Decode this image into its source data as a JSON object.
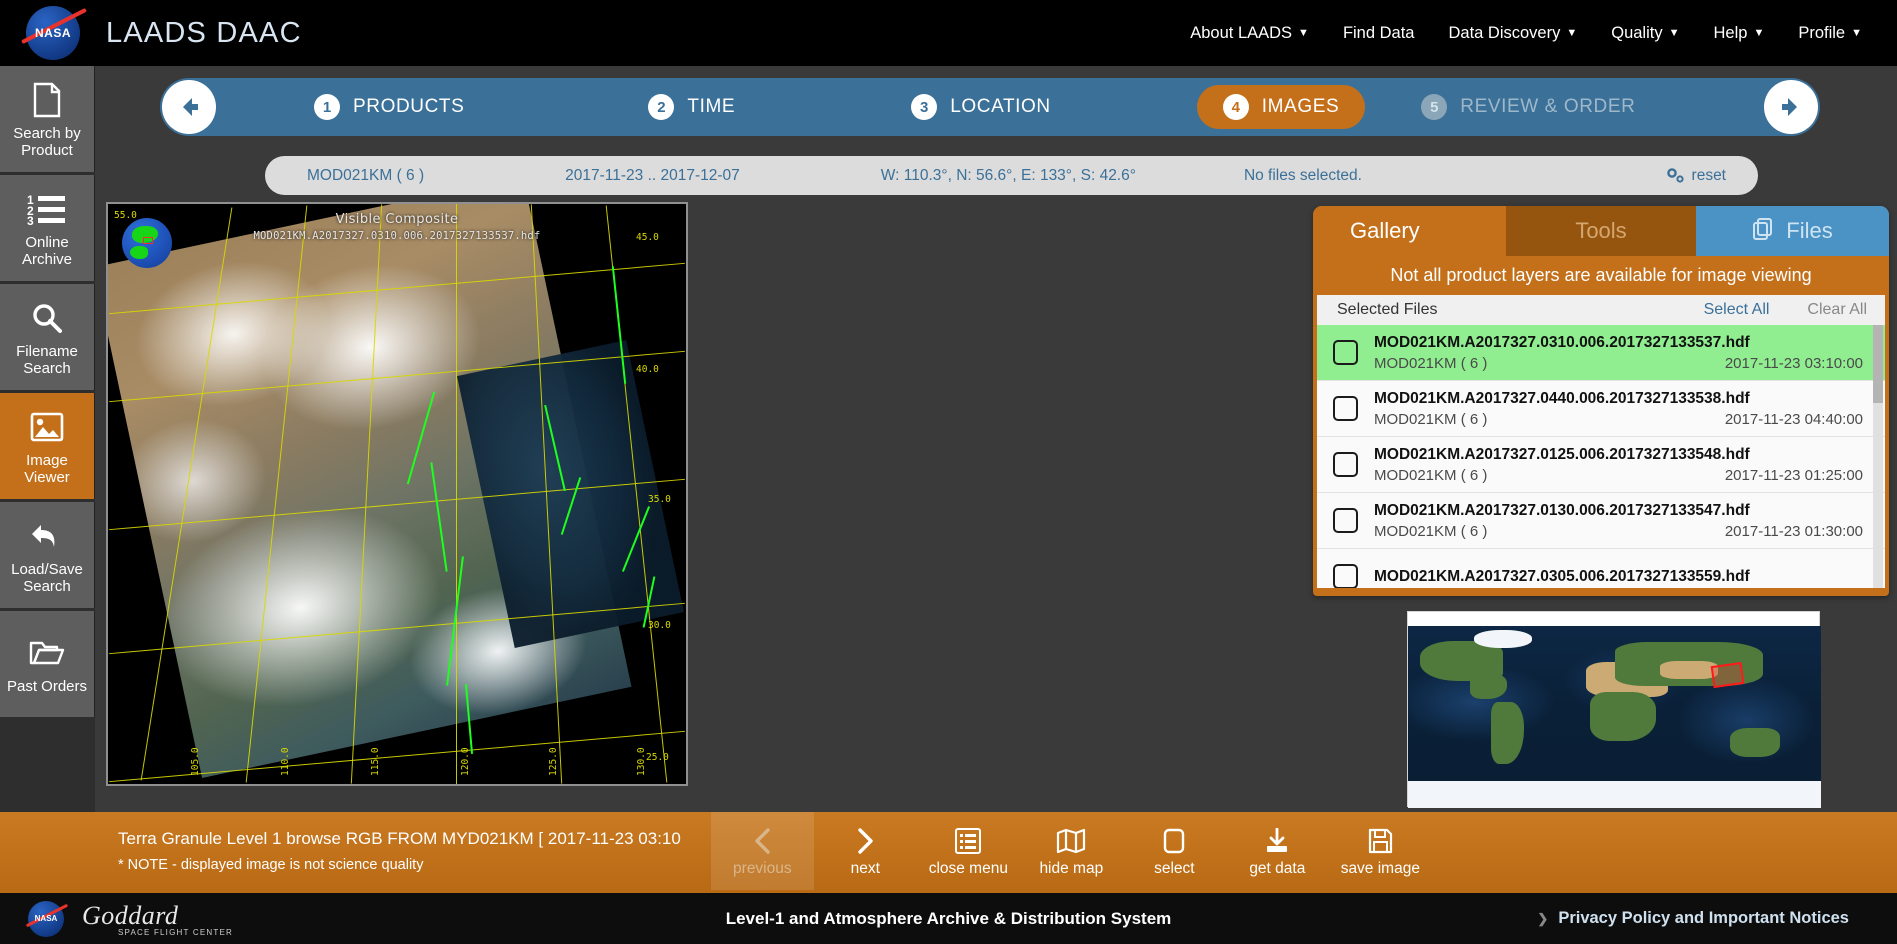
{
  "header": {
    "brand": "LAADS DAAC",
    "logo_alt": "NASA",
    "nav": [
      {
        "label": "About LAADS",
        "has_caret": true
      },
      {
        "label": "Find Data",
        "has_caret": false
      },
      {
        "label": "Data Discovery",
        "has_caret": true
      },
      {
        "label": "Quality",
        "has_caret": true
      },
      {
        "label": "Help",
        "has_caret": true
      },
      {
        "label": "Profile",
        "has_caret": true
      }
    ]
  },
  "sidebar": {
    "items": [
      {
        "label_line1": "Search by",
        "label_line2": "Product",
        "icon": "document-icon",
        "active": false
      },
      {
        "label_line1": "Online",
        "label_line2": "Archive",
        "icon": "numbered-list-icon",
        "active": false
      },
      {
        "label_line1": "Filename",
        "label_line2": "Search",
        "icon": "search-icon",
        "active": false
      },
      {
        "label_line1": "Image",
        "label_line2": "Viewer",
        "icon": "image-icon",
        "active": true
      },
      {
        "label_line1": "Load/Save",
        "label_line2": "Search",
        "icon": "undo-arrow-icon",
        "active": false
      },
      {
        "label_line1": "Past Orders",
        "label_line2": "",
        "icon": "folder-icon",
        "active": false
      }
    ]
  },
  "steps": {
    "back_label": "back",
    "forward_label": "forward",
    "items": [
      {
        "num": "1",
        "label": "PRODUCTS",
        "state": "done"
      },
      {
        "num": "2",
        "label": "TIME",
        "state": "done"
      },
      {
        "num": "3",
        "label": "LOCATION",
        "state": "done"
      },
      {
        "num": "4",
        "label": "IMAGES",
        "state": "current"
      },
      {
        "num": "5",
        "label": "REVIEW & ORDER",
        "state": "disabled"
      }
    ]
  },
  "summary": {
    "product": "MOD021KM ( 6 )",
    "time_range": "2017-11-23 .. 2017-12-07",
    "location": "W: 110.3°, N: 56.6°, E: 133°, S: 42.6°",
    "files_status": "No files selected.",
    "reset_label": "reset"
  },
  "viewer": {
    "title": "Visible Composite",
    "filename": "MOD021KM.A2017327.0310.006.2017327133537.hdf",
    "lat_labels": [
      "55.0",
      "45.0",
      "40.0",
      "35.0",
      "30.0",
      "25.0"
    ],
    "lon_labels": [
      "105.0",
      "110.0",
      "115.0",
      "120.0",
      "125.0",
      "130.0"
    ]
  },
  "gallery": {
    "tabs": [
      {
        "label": "Gallery",
        "state": "active"
      },
      {
        "label": "Tools",
        "state": "inactive"
      },
      {
        "label": "Files",
        "state": "files",
        "icon": "files-icon"
      }
    ],
    "note": "Not all product layers are available for image viewing",
    "list_header": "Selected Files",
    "select_all": "Select All",
    "clear_all": "Clear All",
    "files": [
      {
        "name": "MOD021KM.A2017327.0310.006.2017327133537.hdf",
        "product": "MOD021KM ( 6 )",
        "date": "2017-11-23 03:10:00",
        "selected": true,
        "checked": false
      },
      {
        "name": "MOD021KM.A2017327.0440.006.2017327133538.hdf",
        "product": "MOD021KM ( 6 )",
        "date": "2017-11-23 04:40:00",
        "selected": false,
        "checked": false
      },
      {
        "name": "MOD021KM.A2017327.0125.006.2017327133548.hdf",
        "product": "MOD021KM ( 6 )",
        "date": "2017-11-23 01:25:00",
        "selected": false,
        "checked": false
      },
      {
        "name": "MOD021KM.A2017327.0130.006.2017327133547.hdf",
        "product": "MOD021KM ( 6 )",
        "date": "2017-11-23 01:30:00",
        "selected": false,
        "checked": false
      },
      {
        "name": "MOD021KM.A2017327.0305.006.2017327133559.hdf",
        "product": "",
        "date": "",
        "selected": false,
        "checked": false
      }
    ]
  },
  "bottom": {
    "caption_line1": "Terra Granule Level 1 browse RGB FROM MYD021KM   [ 2017-11-23 03:10",
    "caption_line2": "* NOTE - displayed image is not science quality",
    "actions": [
      {
        "label": "previous",
        "icon": "chevron-left-icon",
        "disabled": true
      },
      {
        "label": "next",
        "icon": "chevron-right-icon",
        "disabled": false
      },
      {
        "label": "close menu",
        "icon": "list-icon",
        "disabled": false
      },
      {
        "label": "hide map",
        "icon": "map-icon",
        "disabled": false
      },
      {
        "label": "select",
        "icon": "checkbox-icon",
        "disabled": false
      },
      {
        "label": "get data",
        "icon": "download-icon",
        "disabled": false
      },
      {
        "label": "save image",
        "icon": "floppy-disk-icon",
        "disabled": false
      }
    ]
  },
  "footer": {
    "goddard_line1": "Goddard",
    "goddard_line2": "SPACE FLIGHT CENTER",
    "title": "Level-1 and Atmosphere Archive & Distribution System",
    "privacy_link": "Privacy Policy and Important Notices"
  },
  "colors": {
    "accent_orange": "#c4701a",
    "step_blue": "#3b7099",
    "files_blue": "#4a93c4",
    "selected_green": "#90ee90",
    "link_blue": "#3b7099"
  }
}
